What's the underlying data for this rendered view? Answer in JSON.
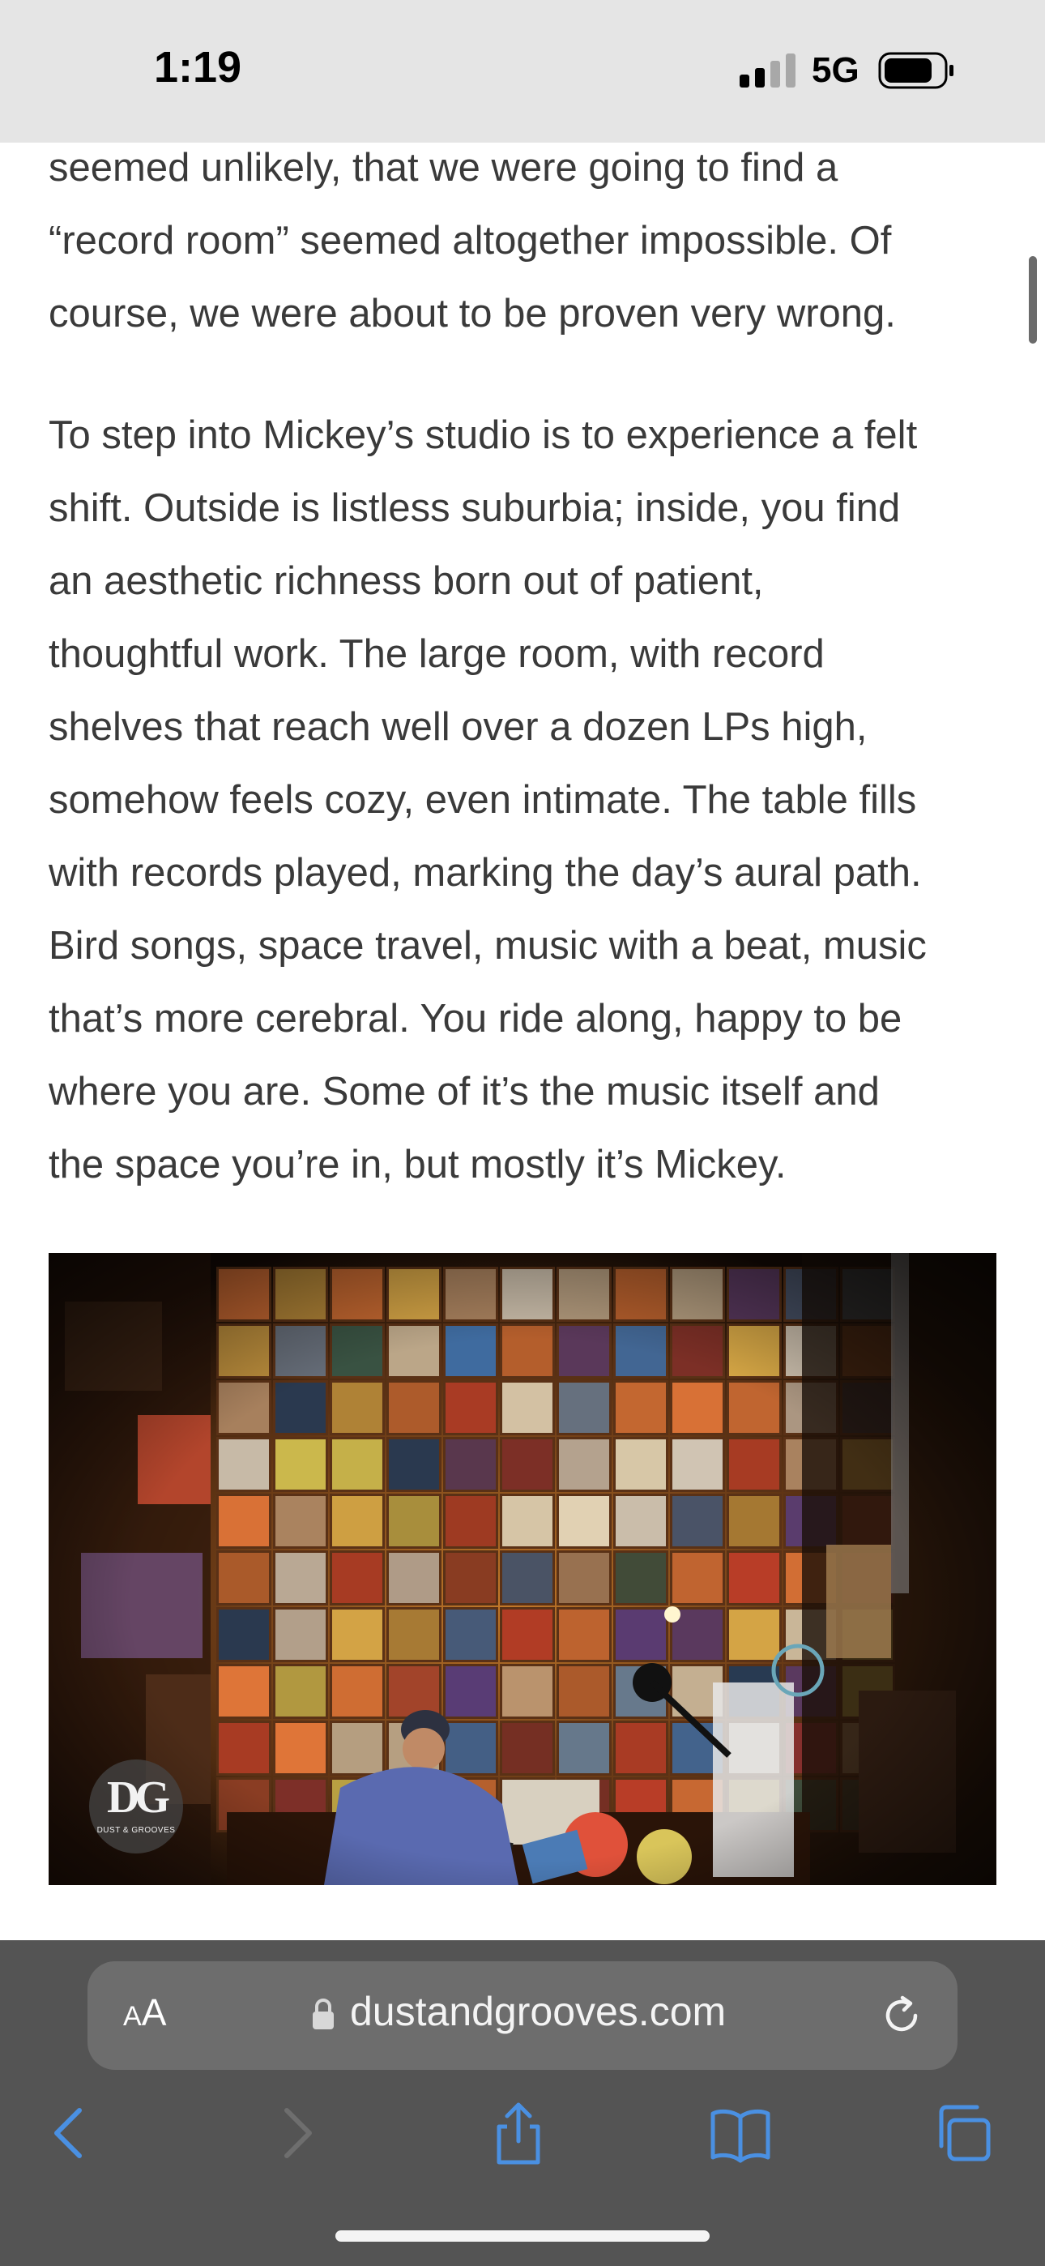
{
  "status_bar": {
    "time": "1:19",
    "network": "5G"
  },
  "article": {
    "paragraph_1_lines": [
      "seemed unlikely, that we were going to find a",
      "“record room” seemed altogether impossible. Of",
      "course, we were about to be proven very wrong."
    ],
    "paragraph_2_lines": [
      "To step into Mickey’s studio is to experience a felt",
      "shift. Outside is listless suburbia; inside, you find",
      "an aesthetic richness born out of patient,",
      "thoughtful work. The large room, with record",
      "shelves that reach well over a dozen LPs high,",
      "somehow feels cozy, even intimate. The table fills",
      "with records played, marking the day’s aural path.",
      "Bird songs, space travel, music with a beat, music",
      "that’s more cerebral. You ride along, happy to be",
      "where you are. Some of it’s the music itself and",
      "the space you’re in, but mostly it’s Mickey."
    ]
  },
  "photo": {
    "logo_mark": "DG",
    "logo_text": "DUST & GROOVES"
  },
  "browser": {
    "aa_label_small": "A",
    "aa_label_large": "A",
    "url": "dustandgrooves.com",
    "icons": [
      "back-icon",
      "forward-icon",
      "share-icon",
      "bookmarks-icon",
      "tabs-icon",
      "lock-icon",
      "reload-icon"
    ],
    "accent_color": "#4a90e2"
  }
}
